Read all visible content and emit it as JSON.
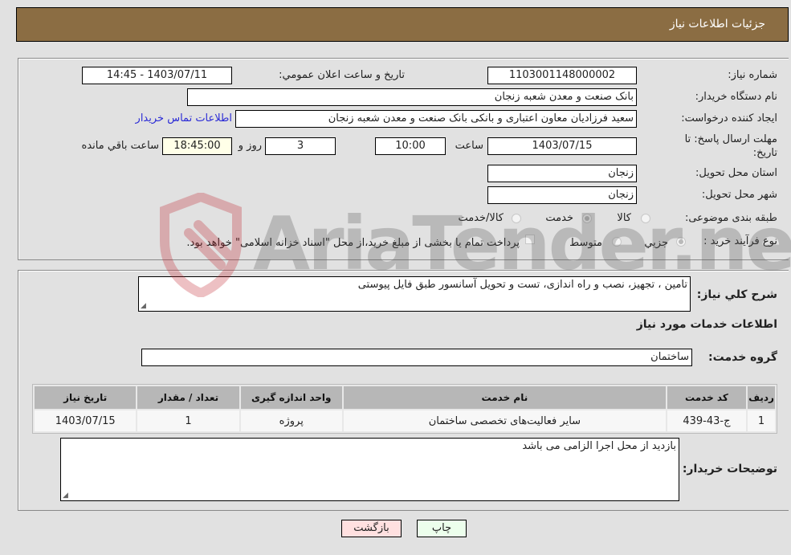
{
  "header": {
    "title": "جزئیات اطلاعات نیاز"
  },
  "form": {
    "need_number_label": "شماره نیاز:",
    "need_number": "1103001148000002",
    "announce_label": "تاریخ و ساعت اعلان عمومي:",
    "announce_value": "1403/07/11 - 14:45",
    "buyer_org_label": "نام دستگاه خريدار:",
    "buyer_org": "بانک صنعت و معدن شعبه زنجان",
    "creator_label": "ایجاد کننده درخواست:",
    "creator": "سعید فرزادیان معاون اعتباری و بانکی بانک صنعت و معدن شعبه زنجان",
    "contact_link": "اطلاعات تماس خريدار",
    "deadline_label": "مهلت ارسال پاسخ: تا تاریخ:",
    "deadline_date": "1403/07/15",
    "time_label": "ساعت",
    "deadline_time": "10:00",
    "days": "3",
    "days_label": "روز و",
    "remaining_time": "18:45:00",
    "remaining_label": "ساعت باقي مانده",
    "province_label": "استان محل تحویل:",
    "province": "زنجان",
    "city_label": "شهر محل تحویل:",
    "city": "زنجان",
    "category_label": "طبقه بندی موضوعی:",
    "category_options": [
      {
        "label": "کالا",
        "checked": false
      },
      {
        "label": "خدمت",
        "checked": true
      },
      {
        "label": "کالا/خدمت",
        "checked": false
      }
    ],
    "process_label": "نوع فرآيند خريد :",
    "process_options": [
      {
        "label": "جزيي",
        "checked": true
      },
      {
        "label": "متوسط",
        "checked": false
      }
    ],
    "treasury_note": "پرداخت تمام يا بخشی از مبلغ خريد،از محل \"اسناد خزانه اسلامی\" خواهد بود.",
    "treasury_checked": false
  },
  "details": {
    "description_label": "شرح کلي نياز:",
    "description": "تامین ، تجهیز، نصب و راه اندازی، تست و تحویل آسانسور طبق فایل پیوستی",
    "services_heading": "اطلاعات خدمات مورد نياز",
    "service_group_label": "گروه خدمت:",
    "service_group": "ساختمان",
    "table": {
      "headers": [
        "رديف",
        "کد خدمت",
        "نام خدمت",
        "واحد اندازه گيری",
        "تعداد / مقدار",
        "تاريخ نياز"
      ],
      "rows": [
        [
          "1",
          "ج-43-439",
          "سایر فعالیت‌های تخصصی ساختمان",
          "پروژه",
          "1",
          "1403/07/15"
        ]
      ]
    },
    "buyer_notes_label": "توضيحات خريدار:",
    "buyer_notes": "بازدید از محل اجرا الزامی می باشد"
  },
  "buttons": {
    "print": "چاپ",
    "back": "بازگشت"
  },
  "watermark": {
    "text": "AriaTender.neT"
  }
}
